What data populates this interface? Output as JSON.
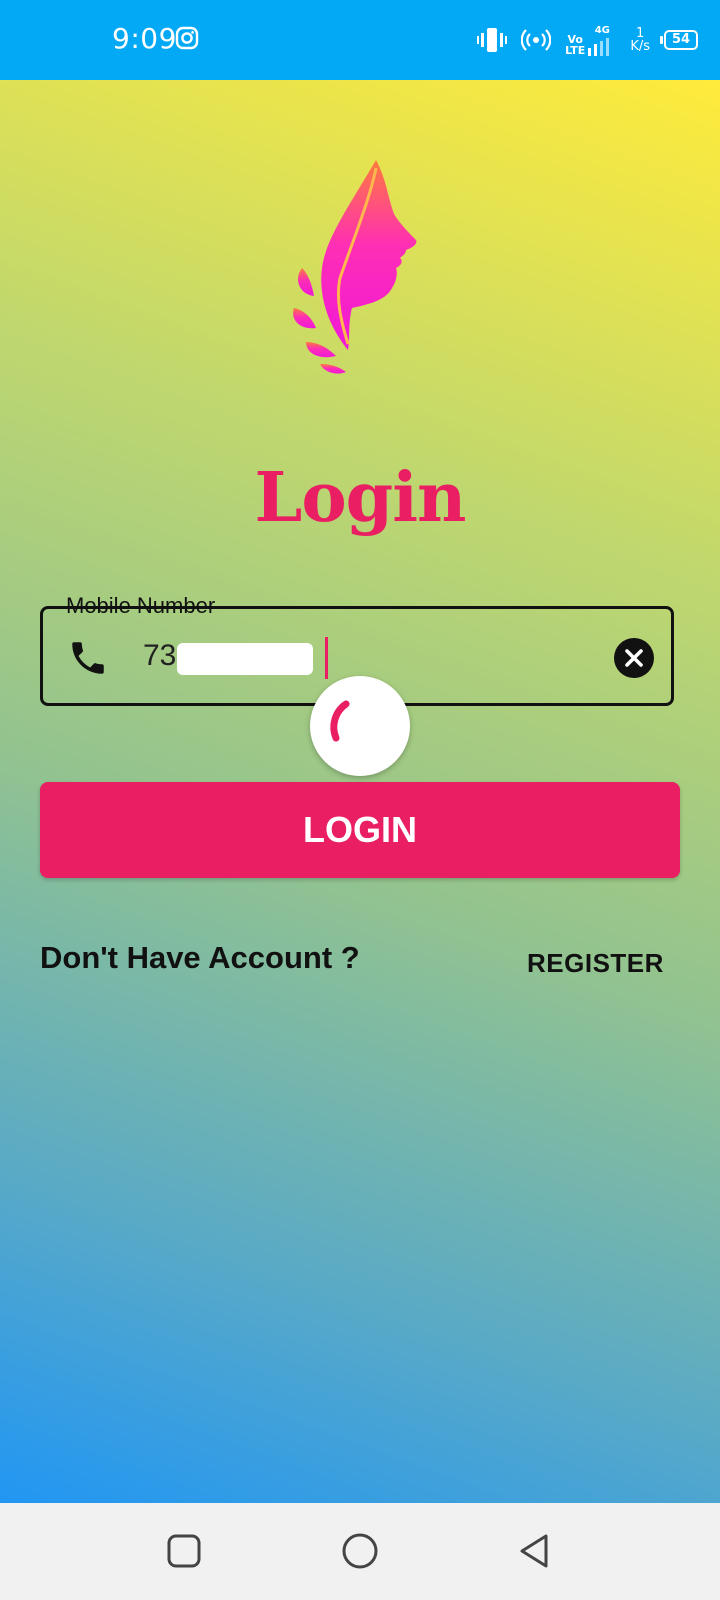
{
  "status_bar": {
    "time": "9:09",
    "network_top": "Vo",
    "network_bottom": "LTE",
    "gen": "4G",
    "speed_value": "1",
    "speed_unit": "K/s",
    "battery": "54",
    "icons": [
      "instagram-icon",
      "vibrate-icon",
      "hotspot-icon",
      "signal-icon",
      "battery-icon"
    ]
  },
  "login": {
    "title": "Login",
    "mobile_label": "Mobile Number",
    "mobile_value": "73",
    "button_label": "LOGIN",
    "no_account_text": "Don't Have Account ?",
    "register_label": "REGISTER"
  },
  "colors": {
    "accent": "#E91E63",
    "status_bar": "#03A9F4",
    "gradient_top": "#FFEB3B",
    "gradient_bottom": "#2196F3"
  },
  "nav": {
    "icons": [
      "recents-icon",
      "home-icon",
      "back-icon"
    ]
  }
}
